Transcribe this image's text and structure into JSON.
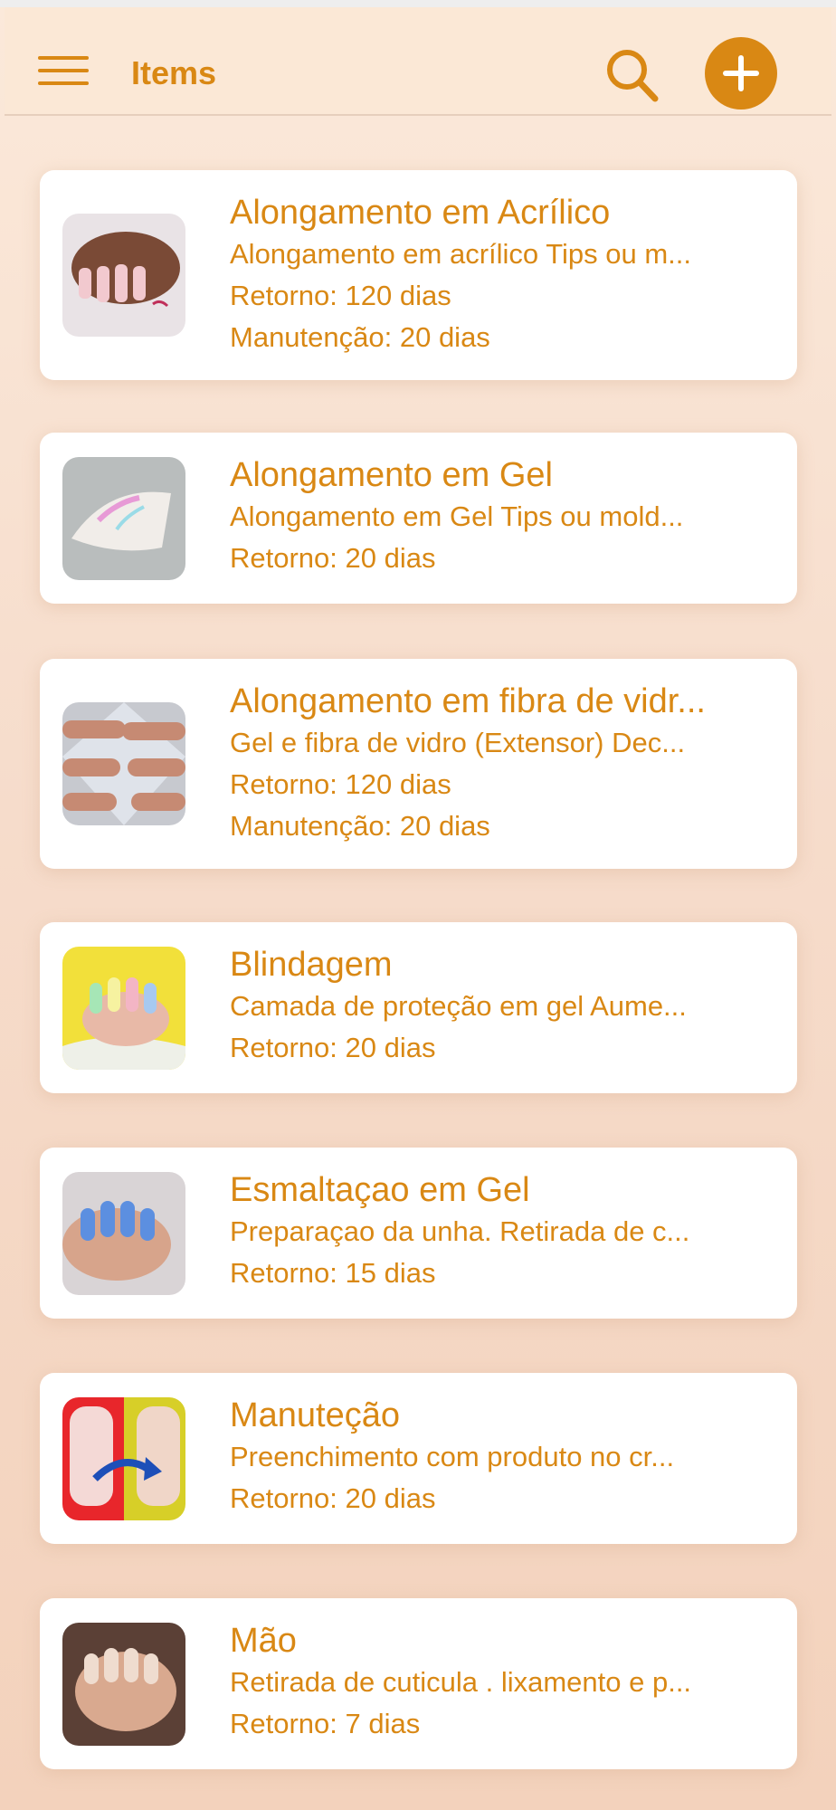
{
  "header": {
    "title": "Items",
    "menu_icon": "hamburger-menu-icon",
    "search_icon": "search-icon",
    "add_icon": "plus-icon"
  },
  "colors": {
    "accent": "#d98814",
    "header_bg": "#fbe8d6",
    "card_bg": "#ffffff"
  },
  "items": [
    {
      "title": "Alongamento em Acrílico",
      "description": "Alongamento em acrílico Tips ou m...",
      "retorno": "Retorno: 120 dias",
      "manutencao": "Manutenção: 20 dias"
    },
    {
      "title": "Alongamento em Gel",
      "description": "Alongamento em Gel Tips ou mold...",
      "retorno": "Retorno: 20 dias"
    },
    {
      "title": "Alongamento em fibra de vidr...",
      "description": "Gel e fibra de vidro (Extensor) Dec...",
      "retorno": "Retorno: 120 dias",
      "manutencao": "Manutenção: 20 dias"
    },
    {
      "title": "Blindagem",
      "description": "Camada de proteção em gel Aume...",
      "retorno": "Retorno: 20 dias"
    },
    {
      "title": "Esmaltaçao em Gel",
      "description": "Preparaçao da unha. Retirada de c...",
      "retorno": "Retorno: 15 dias"
    },
    {
      "title": "Manuteção",
      "description": "Preenchimento com produto no cr...",
      "retorno": "Retorno: 20 dias"
    },
    {
      "title": "Mão",
      "description": "Retirada de cuticula . lixamento e p...",
      "retorno": "Retorno: 7 dias"
    }
  ]
}
